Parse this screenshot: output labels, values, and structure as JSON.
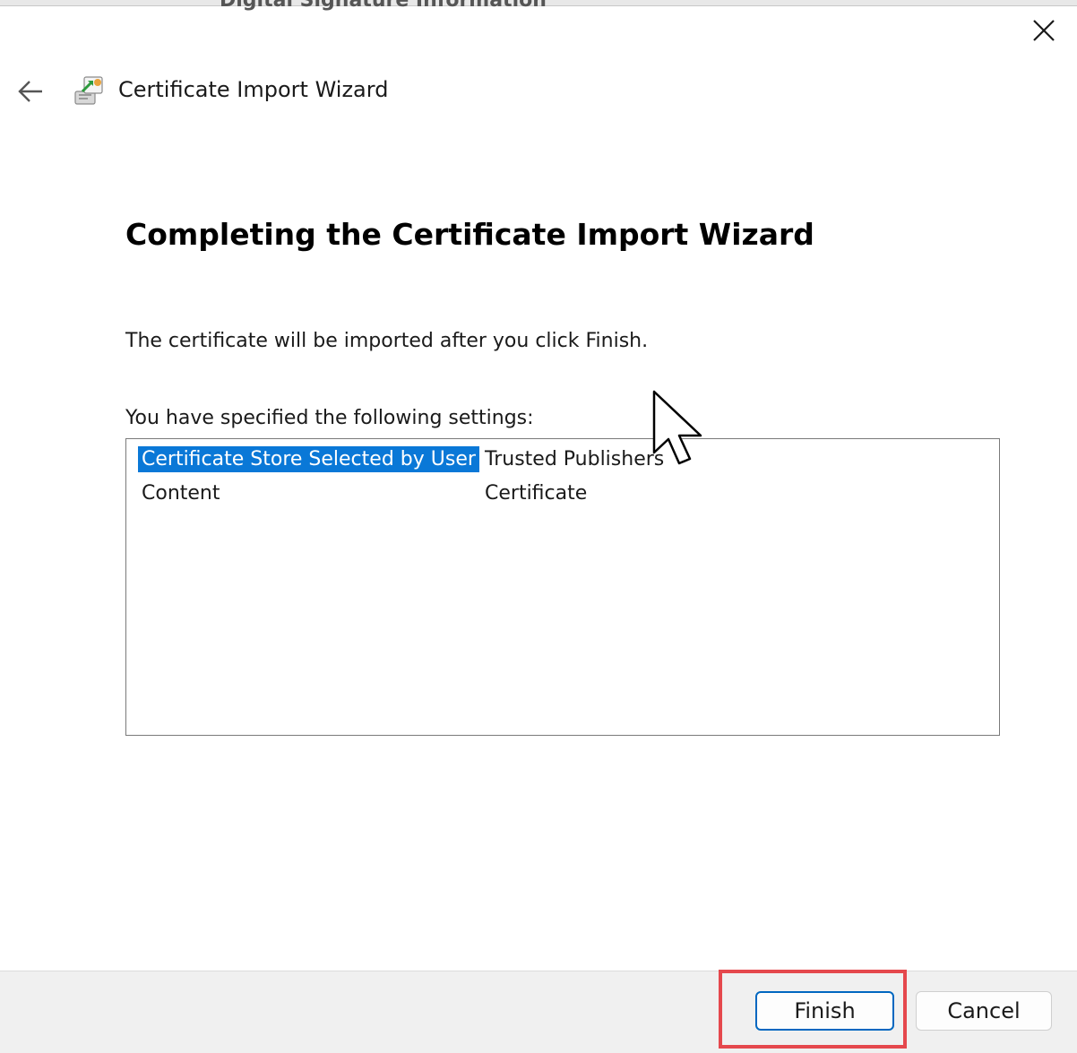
{
  "background_window": {
    "title_fragment": "Digital Signature Information"
  },
  "titlebar": {
    "close_icon": "close-icon",
    "back_icon": "arrow-left-icon",
    "app_icon": "certificate-wizard-icon",
    "title": "Certificate Import Wizard"
  },
  "main": {
    "heading": "Completing the Certificate Import Wizard",
    "info": "The certificate will be imported after you click Finish.",
    "settings_label": "You have specified the following settings:",
    "settings": [
      {
        "key": "Certificate Store Selected by User",
        "value": "Trusted Publishers",
        "selected": true
      },
      {
        "key": "Content",
        "value": "Certificate",
        "selected": false
      }
    ]
  },
  "footer": {
    "finish_label": "Finish",
    "cancel_label": "Cancel"
  },
  "colors": {
    "accent": "#0067c0",
    "selection": "#0a78d7",
    "highlight": "#e5484d",
    "footer_bg": "#f0f0f0"
  }
}
